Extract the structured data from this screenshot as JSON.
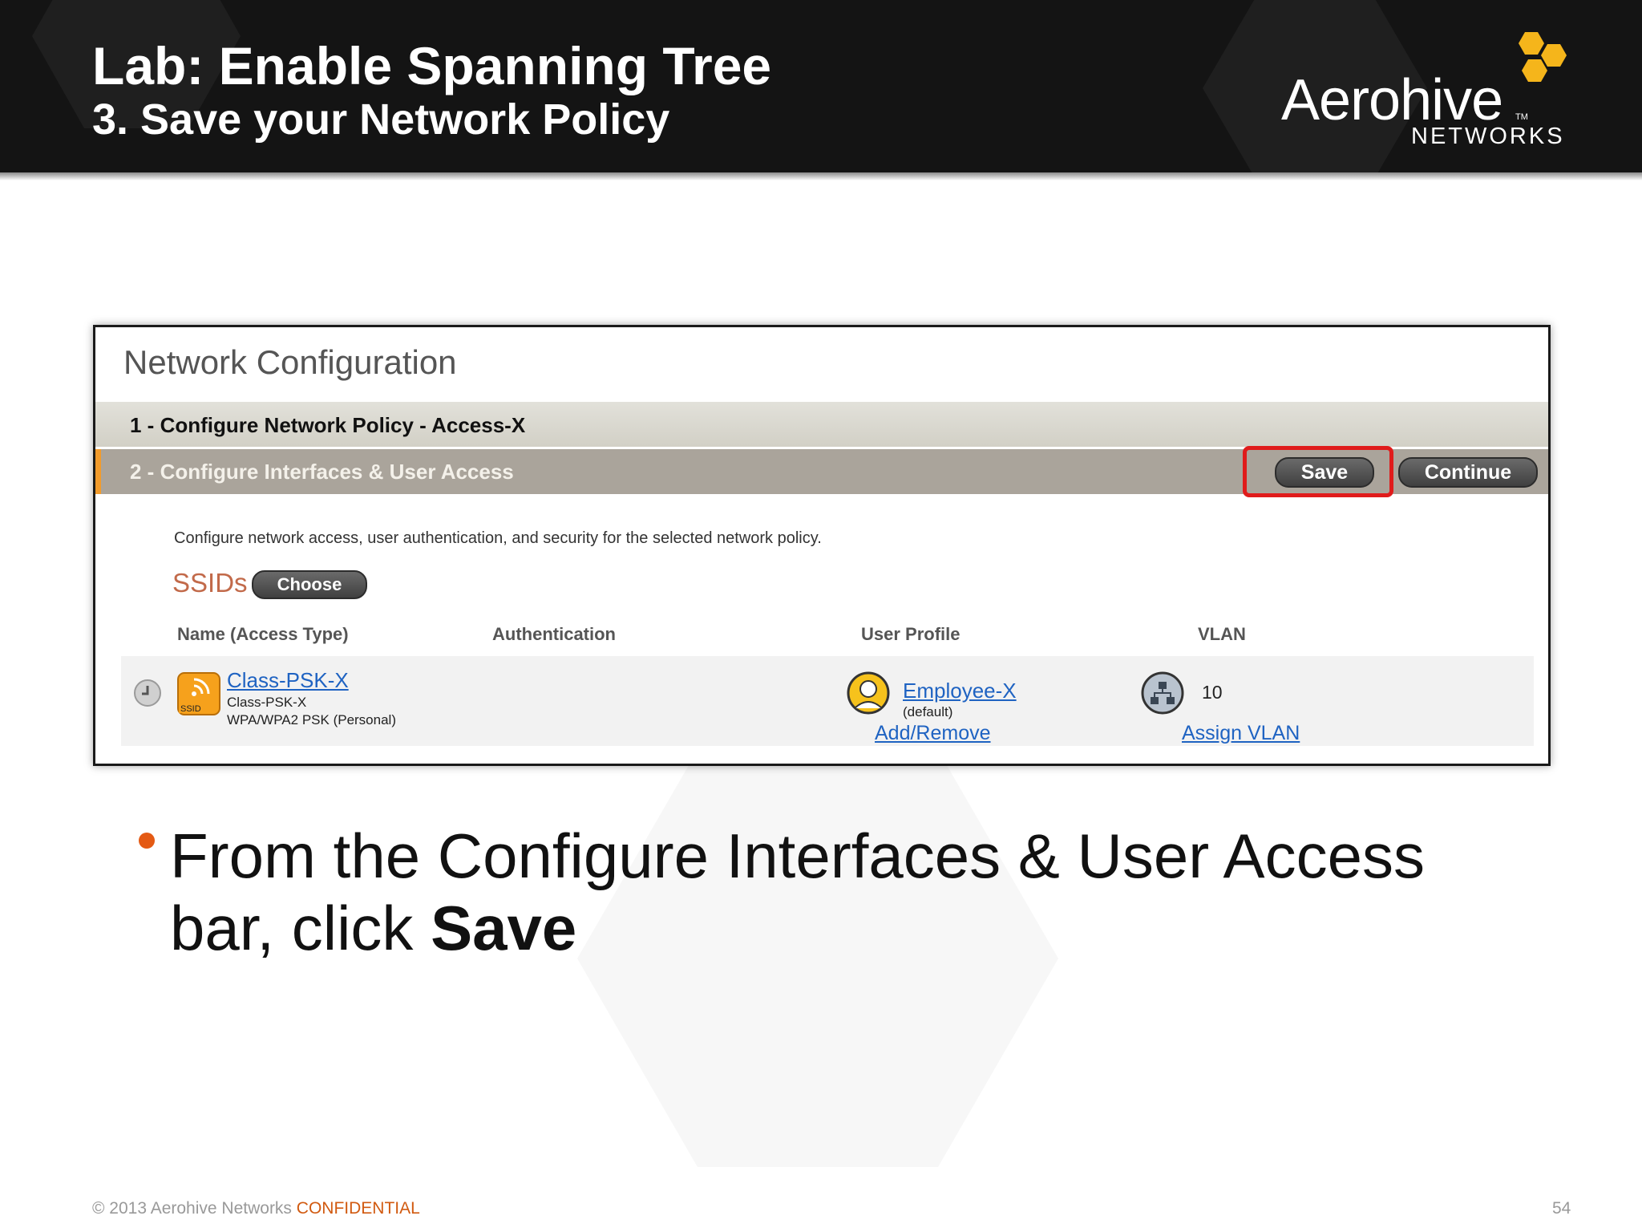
{
  "slide": {
    "title": "Lab: Enable Spanning Tree",
    "subtitle": "3. Save your Network Policy",
    "logo": {
      "word": "Aerohive",
      "tm": "TM",
      "sub": "NETWORKS"
    },
    "brand_colors": {
      "accent": "#f29b2b",
      "bullet": "#e45a14",
      "logo_hex": "#f5b51b",
      "highlight": "#e01b1b"
    }
  },
  "screenshot": {
    "panel_title": "Network Configuration",
    "step1": "1 - Configure Network Policy - Access-X",
    "step2": "2 - Configure Interfaces & User Access",
    "save_label": "Save",
    "continue_label": "Continue",
    "description": "Configure network access, user authentication, and security for the selected network policy.",
    "ssids_label": "SSIDs",
    "choose_label": "Choose",
    "columns": [
      "Name (Access Type)",
      "Authentication",
      "User Profile",
      "VLAN"
    ],
    "row": {
      "ssid_link": "Class-PSK-X",
      "ssid_name": "Class-PSK-X",
      "ssid_auth_type": "WPA/WPA2 PSK (Personal)",
      "ssid_icon_text": "SSID",
      "profile_link": "Employee-X",
      "profile_default": "(default)",
      "add_remove": "Add/Remove",
      "vlan": "10",
      "assign_vlan": "Assign VLAN"
    },
    "icons": [
      "toggle-icon",
      "wifi-ssid-icon",
      "user-profile-icon",
      "vlan-network-icon"
    ]
  },
  "bullet": {
    "text": "From the Configure Interfaces & User Access bar, click ",
    "bold": "Save"
  },
  "footer": {
    "copyright": "© 2013 Aerohive Networks ",
    "confidential": "CONFIDENTIAL",
    "page": "54"
  }
}
